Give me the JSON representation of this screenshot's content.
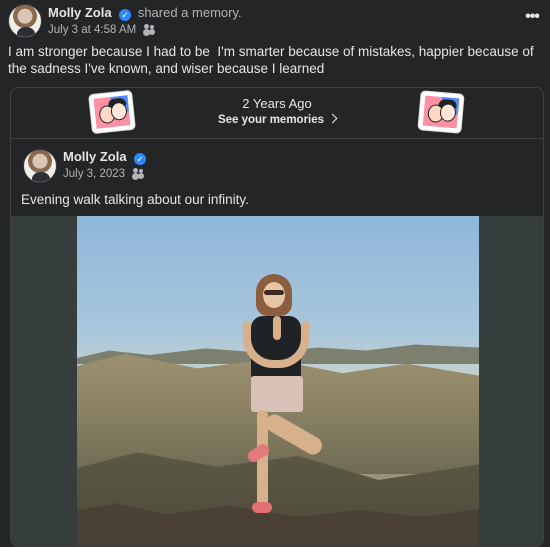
{
  "post": {
    "author": "Molly Zola",
    "action": "shared a memory.",
    "timestamp": "July 3 at 4:58 AM",
    "text": "I am stronger because I had to be  I'm smarter because of mistakes, happier because of the sadness I've known, and wiser because I learned",
    "more_label": "•••"
  },
  "memory": {
    "title": "2 Years Ago",
    "link_label": "See your memories"
  },
  "shared_post": {
    "author": "Molly Zola",
    "date": "July 3, 2023",
    "text": "Evening walk talking about our infinity."
  },
  "icons": {
    "verified": "verified-badge-icon",
    "audience": "friends-audience-icon",
    "more": "more-options-icon",
    "chevron": "chevron-right-icon"
  }
}
